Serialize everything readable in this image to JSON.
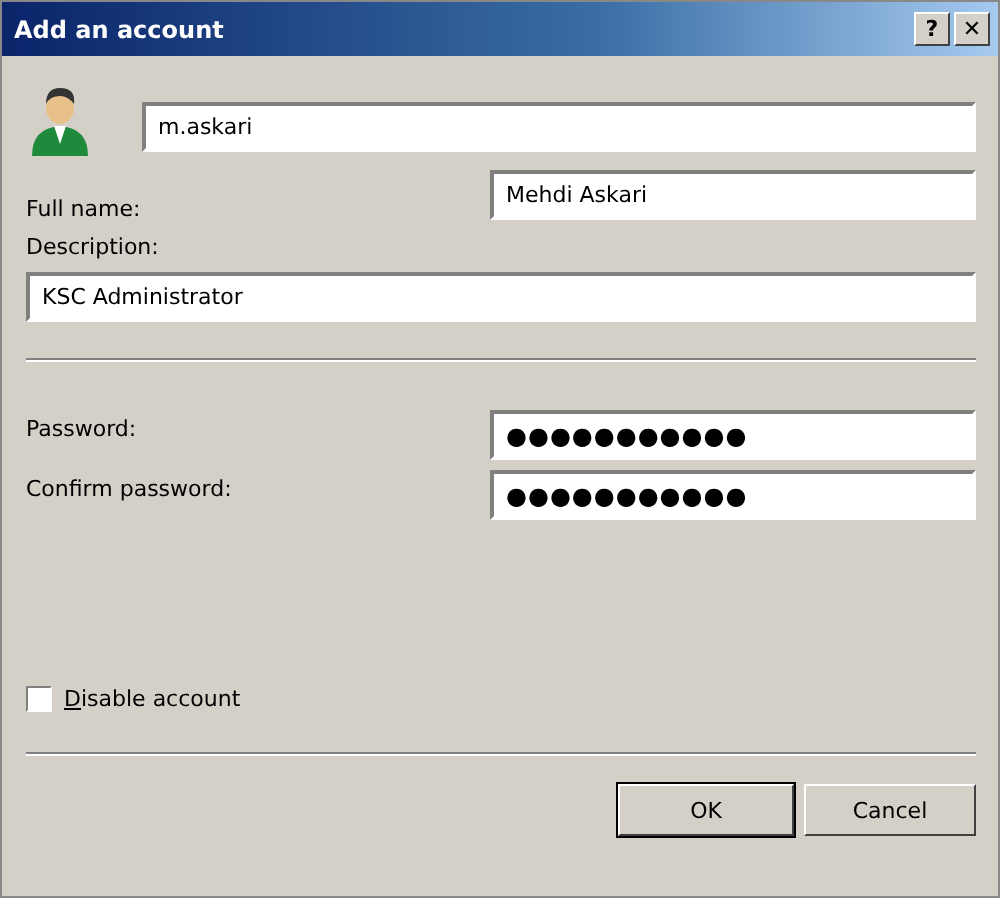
{
  "window": {
    "title": "Add an account",
    "help_button": "?",
    "close_button": "✕"
  },
  "username": {
    "value": "m.askari"
  },
  "full_name": {
    "label": "Full name:",
    "value": "Mehdi Askari"
  },
  "description": {
    "label": "Description:",
    "value": "KSC Administrator"
  },
  "password": {
    "label": "Password:",
    "value": "●●●●●●●●●●●"
  },
  "confirm_password": {
    "label": "Confirm password:",
    "value": "●●●●●●●●●●●"
  },
  "disable_account": {
    "label": "Disable account",
    "checked": false
  },
  "buttons": [
    {
      "label": "OK",
      "default": true
    },
    {
      "label": "Cancel",
      "default": false
    }
  ]
}
